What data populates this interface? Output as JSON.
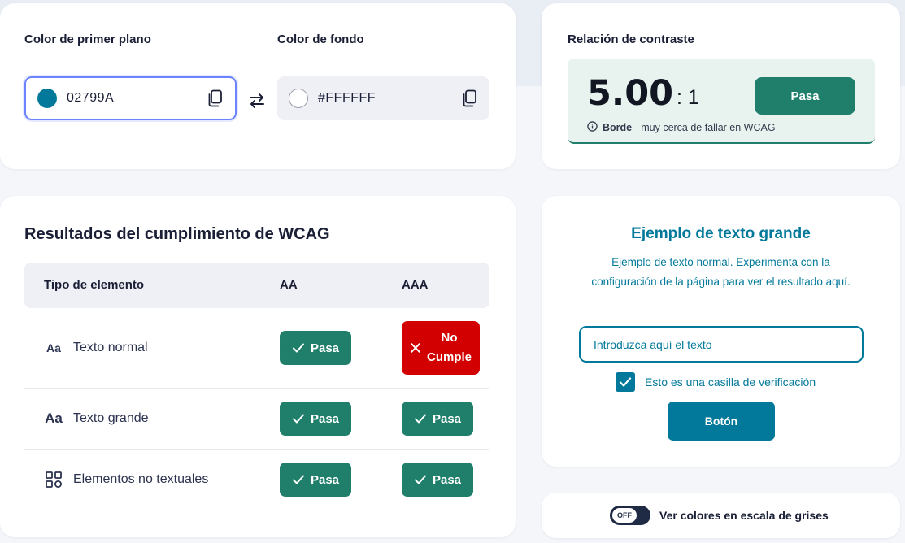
{
  "colors": {
    "foreground_label": "Color de primer plano",
    "foreground_value": "02799A",
    "foreground_swatch": "#02799A",
    "background_label": "Color de fondo",
    "background_value": "#FFFFFF",
    "background_swatch": "#FFFFFF",
    "icons": {
      "copy": "copy-icon",
      "swap": "swap-arrows-icon"
    }
  },
  "ratio": {
    "label": "Relación de contraste",
    "value": "5.00",
    "suffix": ": 1",
    "status": "Pasa",
    "note_strong": "Borde",
    "note_text": " - muy cerca de fallar en WCAG",
    "note_icon": "info-icon"
  },
  "results": {
    "title": "Resultados del cumplimiento de WCAG",
    "headers": {
      "type": "Tipo de elemento",
      "aa": "AA",
      "aaa": "AAA"
    },
    "rows": [
      {
        "icon": "Aa",
        "label": "Texto normal",
        "aa": "Pasa",
        "aaa": "No Cumple",
        "aaa_line1": "No",
        "aaa_line2": "Cumple"
      },
      {
        "icon": "Aa",
        "label": "Texto grande",
        "aa": "Pasa",
        "aaa": "Pasa"
      },
      {
        "icon": "grid-icon",
        "label": "Elementos no textuales",
        "aa": "Pasa",
        "aaa": "Pasa"
      }
    ],
    "status_colors": {
      "pass": "#1F7F6B",
      "fail": "#D20000"
    }
  },
  "sample": {
    "title": "Ejemplo de texto grande",
    "body": "Ejemplo de texto normal. Experimenta con la configuración de la página para ver el resultado aquí.",
    "input_placeholder": "Introduzca aquí el texto",
    "checkbox_label": "Esto es una casilla de verificación",
    "checkbox_checked": true,
    "button_label": "Botón"
  },
  "grayscale": {
    "toggle_state": "OFF",
    "label": "Ver colores en escala de grises"
  },
  "accent": "#02799A"
}
